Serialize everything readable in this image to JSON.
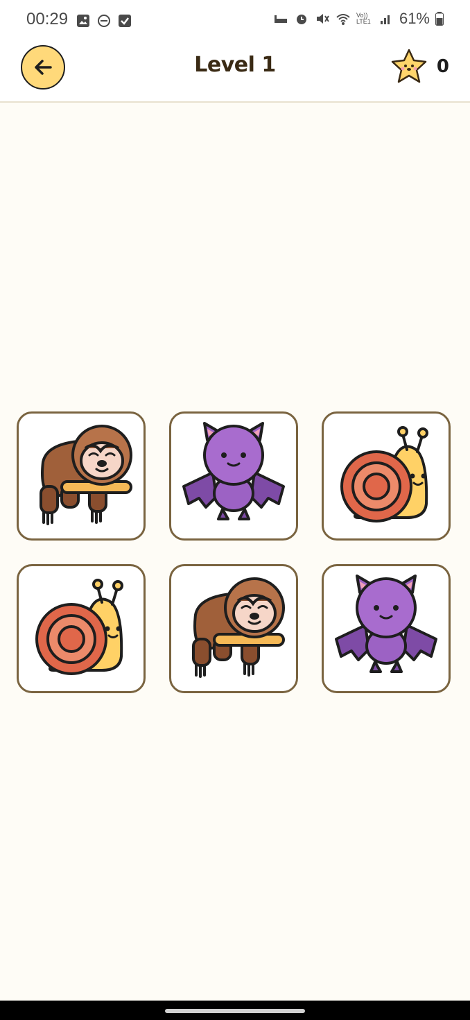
{
  "status_bar": {
    "time": "00:29",
    "battery": "61%",
    "left_icons": [
      "gallery-icon",
      "dnd-icon",
      "checkbox-icon"
    ],
    "right_icons": [
      "sleep-icon",
      "alarm-icon",
      "mute-icon",
      "wifi-icon",
      "volte-icon",
      "signal-icon",
      "battery-icon"
    ],
    "volte_label": "Vo)) LTE1"
  },
  "header": {
    "title": "Level 1",
    "score": "0",
    "back_icon": "arrow-left-icon",
    "score_icon": "star-icon"
  },
  "grid": {
    "cards": [
      {
        "animal": "sloth"
      },
      {
        "animal": "bat"
      },
      {
        "animal": "snail"
      },
      {
        "animal": "snail"
      },
      {
        "animal": "sloth"
      },
      {
        "animal": "bat"
      }
    ]
  },
  "colors": {
    "background": "#FEFCF6",
    "card_border": "#7A6440",
    "back_button": "#FFD97A",
    "star": "#FFD56B"
  }
}
